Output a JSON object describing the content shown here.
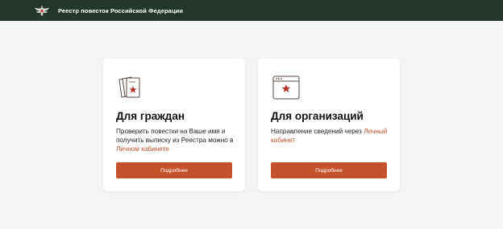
{
  "header": {
    "title": "Реестр повесток Российской Федерации",
    "logo_icon": "double-headed-eagle-emblem",
    "background": "#22382c"
  },
  "cards": [
    {
      "icon": "citizen-documents-star-icon",
      "title": "Для граждан",
      "text_before_link": "Проверить повестки на Ваше имя и получить выписку из Реестра можно в ",
      "link": "Личном кабинете",
      "button": "Подробнее"
    },
    {
      "icon": "organization-window-star-icon",
      "title": "Для организаций",
      "text_before_link": "Направление сведений через ",
      "link": "Личный кабинет",
      "button": "Подробнее"
    }
  ],
  "colors": {
    "accent": "#c4532b",
    "link": "#c4552b",
    "page_background": "#f4f4f4",
    "card_background": "#ffffff"
  }
}
